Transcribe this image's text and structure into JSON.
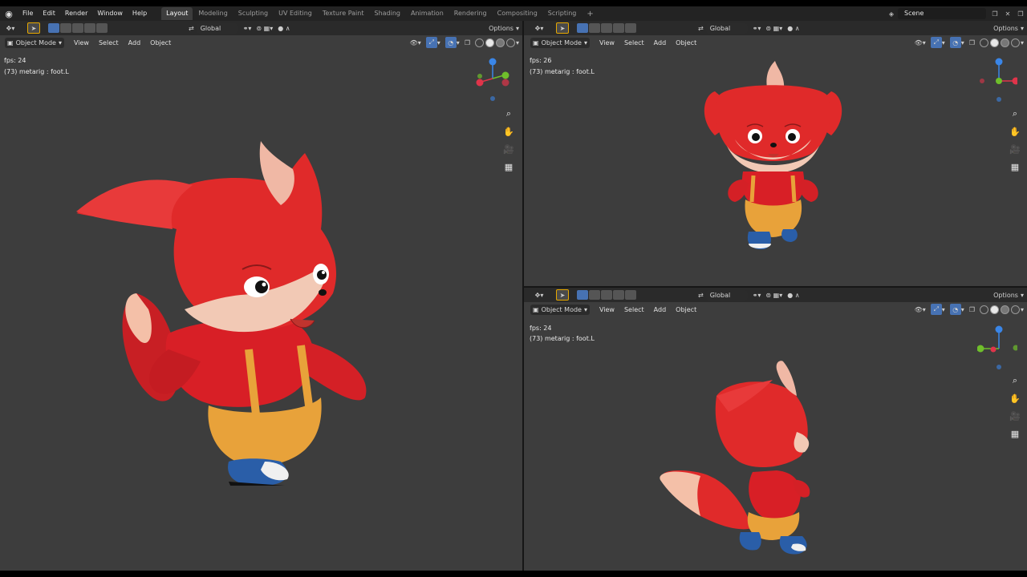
{
  "topbar": {
    "menus": [
      "File",
      "Edit",
      "Render",
      "Window",
      "Help"
    ],
    "workspaces": [
      "Layout",
      "Modeling",
      "Sculpting",
      "UV Editing",
      "Texture Paint",
      "Shading",
      "Animation",
      "Rendering",
      "Compositing",
      "Scripting"
    ],
    "active_workspace": "Layout",
    "scene_name": "Scene"
  },
  "viewports": {
    "left": {
      "mode": "Object Mode",
      "menus": [
        "View",
        "Select",
        "Add",
        "Object"
      ],
      "orientation": "Global",
      "options_label": "Options",
      "fps": "fps: 24",
      "info": "(73) metarig : foot.L"
    },
    "top_right": {
      "mode": "Object Mode",
      "menus": [
        "View",
        "Select",
        "Add",
        "Object"
      ],
      "orientation": "Global",
      "options_label": "Options",
      "fps": "fps: 26",
      "info": "(73) metarig : foot.L"
    },
    "bottom_right": {
      "mode": "Object Mode",
      "menus": [
        "View",
        "Select",
        "Add",
        "Object"
      ],
      "orientation": "Global",
      "options_label": "Options",
      "fps": "fps: 24",
      "info": "(73) metarig : foot.L"
    }
  },
  "icons": {
    "nav": [
      "zoom-icon",
      "pan-hand-icon",
      "camera-icon",
      "grid-icon"
    ]
  },
  "colors": {
    "axis_x": "#e0344a",
    "axis_y": "#6fbf2b",
    "axis_z": "#3a86e8",
    "fox_red": "#e02a2a",
    "overalls": "#e8a23a"
  }
}
